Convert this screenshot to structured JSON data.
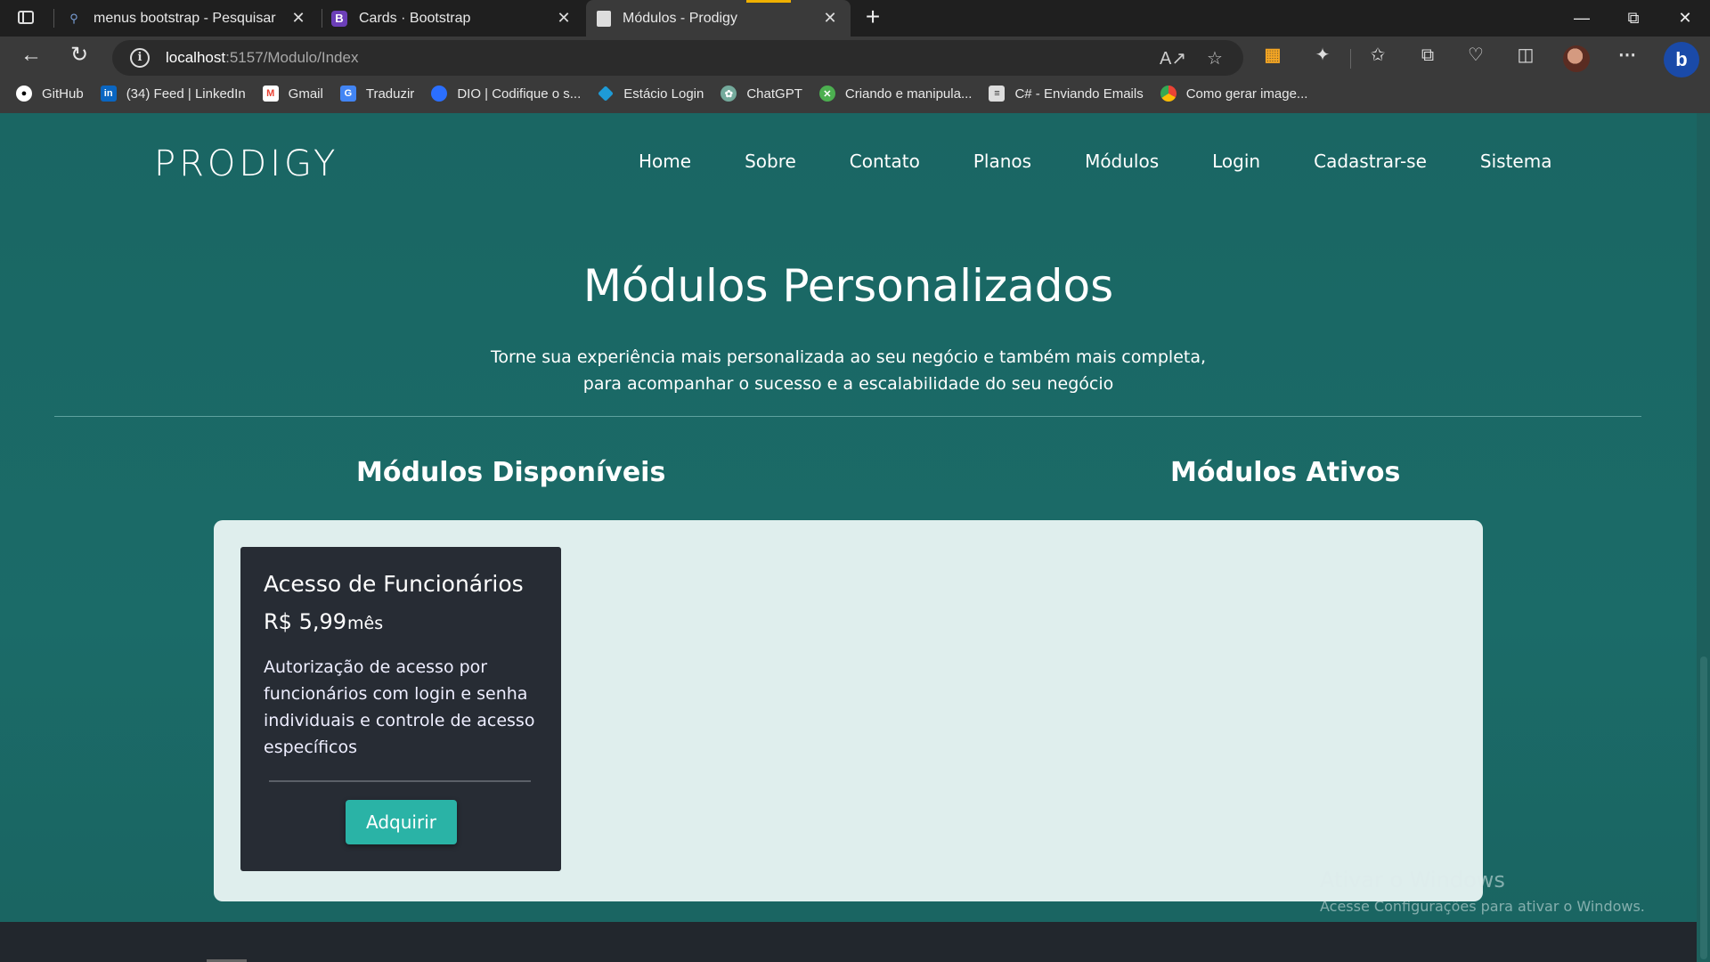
{
  "browser": {
    "tabs": [
      {
        "title": "menus bootstrap - Pesquisar",
        "favicon": "search-icon"
      },
      {
        "title": "Cards · Bootstrap",
        "favicon": "B"
      },
      {
        "title": "Módulos - Prodigy",
        "favicon": "page-icon",
        "active": true
      }
    ],
    "url_host": "localhost",
    "url_path": ":5157/Modulo/Index",
    "bookmarks": [
      {
        "label": "GitHub",
        "icon": "github-icon",
        "color": "#ffffff"
      },
      {
        "label": "(34) Feed | LinkedIn",
        "icon": "in",
        "color": "#0a66c2"
      },
      {
        "label": "Gmail",
        "icon": "M",
        "color": "#ea4335"
      },
      {
        "label": "Traduzir",
        "icon": "G",
        "color": "#4285f4"
      },
      {
        "label": "DIO | Codifique o s...",
        "icon": "D",
        "color": "#2b6fff"
      },
      {
        "label": "Estácio Login",
        "icon": "E",
        "color": "#1e9bd7"
      },
      {
        "label": "ChatGPT",
        "icon": "chatgpt-icon",
        "color": "#74aa9c"
      },
      {
        "label": "Criando e manipula...",
        "icon": "C",
        "color": "#4caf50"
      },
      {
        "label": "C# - Enviando Emails",
        "icon": "doc-icon",
        "color": "#dddddd"
      },
      {
        "label": "Como gerar image...",
        "icon": "chrome-icon",
        "color": "#fbbc05"
      }
    ]
  },
  "site": {
    "logo": "PRODIGY",
    "nav": [
      "Home",
      "Sobre",
      "Contato",
      "Planos",
      "Módulos",
      "Login",
      "Cadastrar-se",
      "Sistema"
    ],
    "hero_title": "Módulos Personalizados",
    "hero_sub_line1": "Torne sua experiência mais personalizada ao seu negócio e também mais completa,",
    "hero_sub_line2": "para acompanhar o sucesso e a escalabilidade do seu negócio",
    "available_title": "Módulos Disponíveis",
    "active_title": "Módulos Ativos",
    "card": {
      "title": "Acesso de Funcionários",
      "price": "R$ 5,99",
      "period": "mês",
      "description": "Autorização de acesso por funcionários com login e senha individuais e controle de acesso específicos",
      "button": "Adquirir"
    },
    "watermark_title": "Ativar o Windows",
    "watermark_sub": "Acesse Configurações para ativar o Windows."
  },
  "colors": {
    "page_bg": "#1a6663",
    "panel_bg": "#dfeeed",
    "card_bg": "#272c34",
    "button_bg": "#2ab3a6",
    "tab_accent": "#f0b000"
  }
}
